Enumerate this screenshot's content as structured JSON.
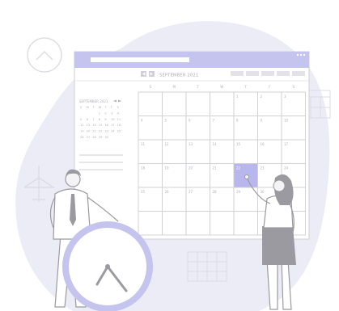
{
  "calendar": {
    "month_title": "SEPTEMBER 2021",
    "weekdays": [
      "S",
      "M",
      "T",
      "W",
      "T",
      "F",
      "S"
    ],
    "weeks": [
      [
        "",
        "",
        "",
        "",
        "1",
        "2",
        "3"
      ],
      [
        "4",
        "5",
        "6",
        "7",
        "8",
        "9",
        "10"
      ],
      [
        "11",
        "12",
        "13",
        "14",
        "15",
        "16",
        "17"
      ],
      [
        "18",
        "19",
        "20",
        "21",
        "22",
        "23",
        "24"
      ],
      [
        "25",
        "26",
        "27",
        "28",
        "29",
        "30",
        ""
      ],
      [
        "",
        "",
        "",
        "",
        "",
        "",
        ""
      ]
    ],
    "highlighted_day": "22",
    "mini_calendar": {
      "title": "SEPTEMBER 2021",
      "weekdays": [
        "S",
        "M",
        "T",
        "W",
        "T",
        "F",
        "S"
      ],
      "weeks": [
        [
          "",
          "",
          "",
          "1",
          "2",
          "3",
          "4"
        ],
        [
          "5",
          "6",
          "7",
          "8",
          "9",
          "10",
          "11"
        ],
        [
          "12",
          "13",
          "14",
          "15",
          "16",
          "17",
          "18"
        ],
        [
          "19",
          "20",
          "21",
          "22",
          "23",
          "24",
          "25"
        ],
        [
          "26",
          "27",
          "28",
          "29",
          "30",
          "",
          ""
        ]
      ]
    }
  },
  "colors": {
    "blob": "#ececf6",
    "accent": "#c4c4ef",
    "highlight": "#b9b6ee",
    "line": "#cfcfd4",
    "figure": "#9a9aa0",
    "skin": "#f4f4f6"
  },
  "icons": {
    "up_chevron": "chevron-up-icon",
    "airplane": "airplane-icon",
    "clock": "clock-icon",
    "prev": "chevron-left-icon",
    "next": "chevron-right-icon"
  }
}
